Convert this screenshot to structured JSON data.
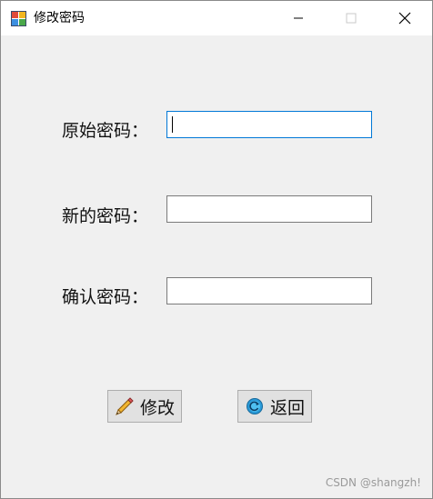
{
  "window": {
    "title": "修改密码",
    "controls": {
      "minimize": "minimize",
      "maximize": "maximize",
      "close": "close"
    }
  },
  "form": {
    "old_password_label": "原始密码：",
    "new_password_label": "新的密码：",
    "confirm_password_label": "确认密码：",
    "old_password_value": "",
    "new_password_value": "",
    "confirm_password_value": ""
  },
  "buttons": {
    "modify_label": "修改",
    "back_label": "返回"
  },
  "icons": {
    "app": "form-app-icon",
    "modify": "pencil-icon",
    "back": "back-arrow-icon"
  },
  "watermark": "CSDN @shangzh!"
}
